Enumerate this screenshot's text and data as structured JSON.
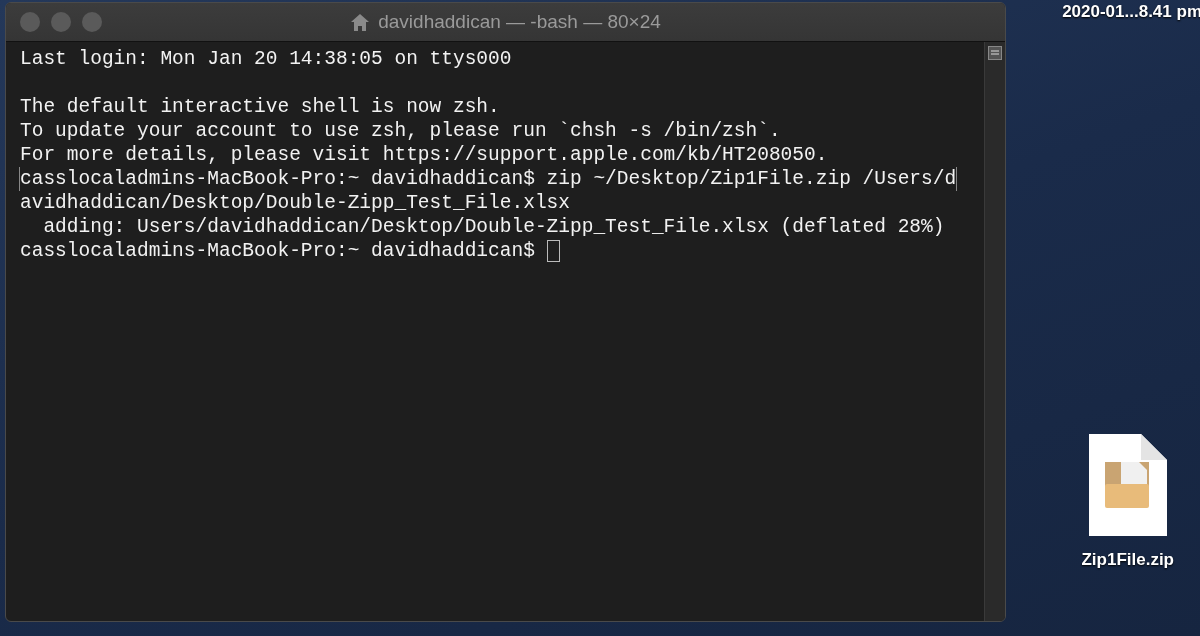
{
  "window": {
    "title": "davidhaddican — -bash — 80×24"
  },
  "terminal": {
    "lines": [
      {
        "kind": "text",
        "text": "Last login: Mon Jan 20 14:38:05 on ttys000",
        "marked": false
      },
      {
        "kind": "blank"
      },
      {
        "kind": "text",
        "text": "The default interactive shell is now zsh.",
        "marked": false
      },
      {
        "kind": "text",
        "text": "To update your account to use zsh, please run `chsh -s /bin/zsh`.",
        "marked": false
      },
      {
        "kind": "text",
        "text": "For more details, please visit https://support.apple.com/kb/HT208050.",
        "marked": false
      },
      {
        "kind": "text",
        "text": "casslocaladmins-MacBook-Pro:~ davidhaddican$ zip ~/Desktop/Zip1File.zip /Users/d",
        "marked": true
      },
      {
        "kind": "text",
        "text": "avidhaddican/Desktop/Double-Zipp_Test_File.xlsx",
        "marked": false
      },
      {
        "kind": "text",
        "text": "  adding: Users/davidhaddican/Desktop/Double-Zipp_Test_File.xlsx (deflated 28%)",
        "marked": false
      },
      {
        "kind": "prompt",
        "text": "casslocaladmins-MacBook-Pro:~ davidhaddican$ ",
        "marked": false
      }
    ]
  },
  "desktop": {
    "items": [
      {
        "kind": "screenshot",
        "label": "2020-01...8.41 pm"
      },
      {
        "kind": "zip",
        "label": "Zip1File.zip"
      }
    ]
  }
}
